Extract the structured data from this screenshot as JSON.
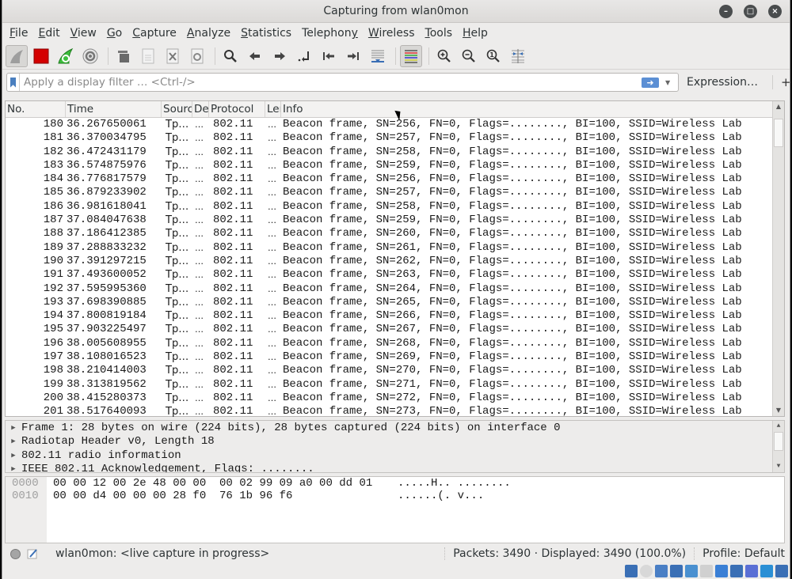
{
  "window": {
    "title": "Capturing from wlan0mon",
    "controls": [
      "minimize",
      "maximize",
      "close"
    ]
  },
  "menubar": [
    {
      "label": "File",
      "mnemonic": "F"
    },
    {
      "label": "Edit",
      "mnemonic": "E"
    },
    {
      "label": "View",
      "mnemonic": "V"
    },
    {
      "label": "Go",
      "mnemonic": "G"
    },
    {
      "label": "Capture",
      "mnemonic": "C"
    },
    {
      "label": "Analyze",
      "mnemonic": "A"
    },
    {
      "label": "Statistics",
      "mnemonic": "S"
    },
    {
      "label": "Telephony",
      "mnemonic": "y"
    },
    {
      "label": "Wireless",
      "mnemonic": "W"
    },
    {
      "label": "Tools",
      "mnemonic": "T"
    },
    {
      "label": "Help",
      "mnemonic": "H"
    }
  ],
  "toolbar": {
    "buttons": [
      {
        "icon": "start-capture-icon",
        "pressed": true
      },
      {
        "icon": "stop-capture-icon"
      },
      {
        "icon": "restart-capture-icon"
      },
      {
        "icon": "capture-options-icon"
      },
      {
        "icon": "open-file-icon"
      },
      {
        "icon": "save-file-icon"
      },
      {
        "icon": "close-file-icon"
      },
      {
        "icon": "reload-file-icon"
      },
      {
        "icon": "find-packet-icon"
      },
      {
        "icon": "go-back-icon"
      },
      {
        "icon": "go-forward-icon"
      },
      {
        "icon": "go-to-packet-icon"
      },
      {
        "icon": "first-packet-icon"
      },
      {
        "icon": "last-packet-icon"
      },
      {
        "icon": "auto-scroll-icon"
      },
      {
        "icon": "colorize-icon",
        "pressed": true
      },
      {
        "icon": "zoom-in-icon"
      },
      {
        "icon": "zoom-out-icon"
      },
      {
        "icon": "normal-size-icon"
      },
      {
        "icon": "resize-columns-icon"
      }
    ]
  },
  "filter": {
    "placeholder": "Apply a display filter … <Ctrl-/>",
    "value": "",
    "expression_label": "Expression…",
    "add_label": "+"
  },
  "packet_list": {
    "columns": [
      "No.",
      "Time",
      "Sourc",
      "De",
      "Protocol",
      "Ler",
      "Info"
    ],
    "rows": [
      {
        "no": "180",
        "time": "36.267650061",
        "src": "Tp…",
        "dst": "…",
        "proto": "802.11",
        "len": "…",
        "info": "Beacon frame, SN=256, FN=0, Flags=........, BI=100, SSID=Wireless Lab"
      },
      {
        "no": "181",
        "time": "36.370034795",
        "src": "Tp…",
        "dst": "…",
        "proto": "802.11",
        "len": "…",
        "info": "Beacon frame, SN=257, FN=0, Flags=........, BI=100, SSID=Wireless Lab"
      },
      {
        "no": "182",
        "time": "36.472431179",
        "src": "Tp…",
        "dst": "…",
        "proto": "802.11",
        "len": "…",
        "info": "Beacon frame, SN=258, FN=0, Flags=........, BI=100, SSID=Wireless Lab"
      },
      {
        "no": "183",
        "time": "36.574875976",
        "src": "Tp…",
        "dst": "…",
        "proto": "802.11",
        "len": "…",
        "info": "Beacon frame, SN=259, FN=0, Flags=........, BI=100, SSID=Wireless Lab"
      },
      {
        "no": "184",
        "time": "36.776817579",
        "src": "Tp…",
        "dst": "…",
        "proto": "802.11",
        "len": "…",
        "info": "Beacon frame, SN=256, FN=0, Flags=........, BI=100, SSID=Wireless Lab"
      },
      {
        "no": "185",
        "time": "36.879233902",
        "src": "Tp…",
        "dst": "…",
        "proto": "802.11",
        "len": "…",
        "info": "Beacon frame, SN=257, FN=0, Flags=........, BI=100, SSID=Wireless Lab"
      },
      {
        "no": "186",
        "time": "36.981618041",
        "src": "Tp…",
        "dst": "…",
        "proto": "802.11",
        "len": "…",
        "info": "Beacon frame, SN=258, FN=0, Flags=........, BI=100, SSID=Wireless Lab"
      },
      {
        "no": "187",
        "time": "37.084047638",
        "src": "Tp…",
        "dst": "…",
        "proto": "802.11",
        "len": "…",
        "info": "Beacon frame, SN=259, FN=0, Flags=........, BI=100, SSID=Wireless Lab"
      },
      {
        "no": "188",
        "time": "37.186412385",
        "src": "Tp…",
        "dst": "…",
        "proto": "802.11",
        "len": "…",
        "info": "Beacon frame, SN=260, FN=0, Flags=........, BI=100, SSID=Wireless Lab"
      },
      {
        "no": "189",
        "time": "37.288833232",
        "src": "Tp…",
        "dst": "…",
        "proto": "802.11",
        "len": "…",
        "info": "Beacon frame, SN=261, FN=0, Flags=........, BI=100, SSID=Wireless Lab"
      },
      {
        "no": "190",
        "time": "37.391297215",
        "src": "Tp…",
        "dst": "…",
        "proto": "802.11",
        "len": "…",
        "info": "Beacon frame, SN=262, FN=0, Flags=........, BI=100, SSID=Wireless Lab"
      },
      {
        "no": "191",
        "time": "37.493600052",
        "src": "Tp…",
        "dst": "…",
        "proto": "802.11",
        "len": "…",
        "info": "Beacon frame, SN=263, FN=0, Flags=........, BI=100, SSID=Wireless Lab"
      },
      {
        "no": "192",
        "time": "37.595995360",
        "src": "Tp…",
        "dst": "…",
        "proto": "802.11",
        "len": "…",
        "info": "Beacon frame, SN=264, FN=0, Flags=........, BI=100, SSID=Wireless Lab"
      },
      {
        "no": "193",
        "time": "37.698390885",
        "src": "Tp…",
        "dst": "…",
        "proto": "802.11",
        "len": "…",
        "info": "Beacon frame, SN=265, FN=0, Flags=........, BI=100, SSID=Wireless Lab"
      },
      {
        "no": "194",
        "time": "37.800819184",
        "src": "Tp…",
        "dst": "…",
        "proto": "802.11",
        "len": "…",
        "info": "Beacon frame, SN=266, FN=0, Flags=........, BI=100, SSID=Wireless Lab"
      },
      {
        "no": "195",
        "time": "37.903225497",
        "src": "Tp…",
        "dst": "…",
        "proto": "802.11",
        "len": "…",
        "info": "Beacon frame, SN=267, FN=0, Flags=........, BI=100, SSID=Wireless Lab"
      },
      {
        "no": "196",
        "time": "38.005608955",
        "src": "Tp…",
        "dst": "…",
        "proto": "802.11",
        "len": "…",
        "info": "Beacon frame, SN=268, FN=0, Flags=........, BI=100, SSID=Wireless Lab"
      },
      {
        "no": "197",
        "time": "38.108016523",
        "src": "Tp…",
        "dst": "…",
        "proto": "802.11",
        "len": "…",
        "info": "Beacon frame, SN=269, FN=0, Flags=........, BI=100, SSID=Wireless Lab"
      },
      {
        "no": "198",
        "time": "38.210414003",
        "src": "Tp…",
        "dst": "…",
        "proto": "802.11",
        "len": "…",
        "info": "Beacon frame, SN=270, FN=0, Flags=........, BI=100, SSID=Wireless Lab"
      },
      {
        "no": "199",
        "time": "38.313819562",
        "src": "Tp…",
        "dst": "…",
        "proto": "802.11",
        "len": "…",
        "info": "Beacon frame, SN=271, FN=0, Flags=........, BI=100, SSID=Wireless Lab"
      },
      {
        "no": "200",
        "time": "38.415280373",
        "src": "Tp…",
        "dst": "…",
        "proto": "802.11",
        "len": "…",
        "info": "Beacon frame, SN=272, FN=0, Flags=........, BI=100, SSID=Wireless Lab"
      },
      {
        "no": "201",
        "time": "38.517640093",
        "src": "Tp…",
        "dst": "…",
        "proto": "802.11",
        "len": "…",
        "info": "Beacon frame, SN=273, FN=0, Flags=........, BI=100, SSID=Wireless Lab"
      }
    ]
  },
  "details": [
    "Frame 1: 28 bytes on wire (224 bits), 28 bytes captured (224 bits) on interface 0",
    "Radiotap Header v0, Length 18",
    "802.11 radio information",
    "IEEE 802.11 Acknowledgement, Flags: ........"
  ],
  "bytes": [
    {
      "offset": "0000",
      "hex": "00 00 12 00 2e 48 00 00  00 02 99 09 a0 00 dd 01",
      "ascii": ".....H.. ........"
    },
    {
      "offset": "0010",
      "hex": "00 00 d4 00 00 00 28 f0  76 1b 96 f6",
      "ascii": "......(. v..."
    }
  ],
  "statusbar": {
    "capture_text": "wlan0mon: <live capture in progress>",
    "packets_text": "Packets: 3490 · Displayed: 3490 (100.0%)",
    "profile_text": "Profile: Default"
  },
  "tray_icons": [
    "network-disabled-icon",
    "optical-drive-icon",
    "audio-icon",
    "network-icon",
    "usb-icon",
    "shared-folder-icon",
    "display-icon",
    "multi-display-icon",
    "recording-icon",
    "mouse-integration-icon",
    "host-key-icon"
  ]
}
